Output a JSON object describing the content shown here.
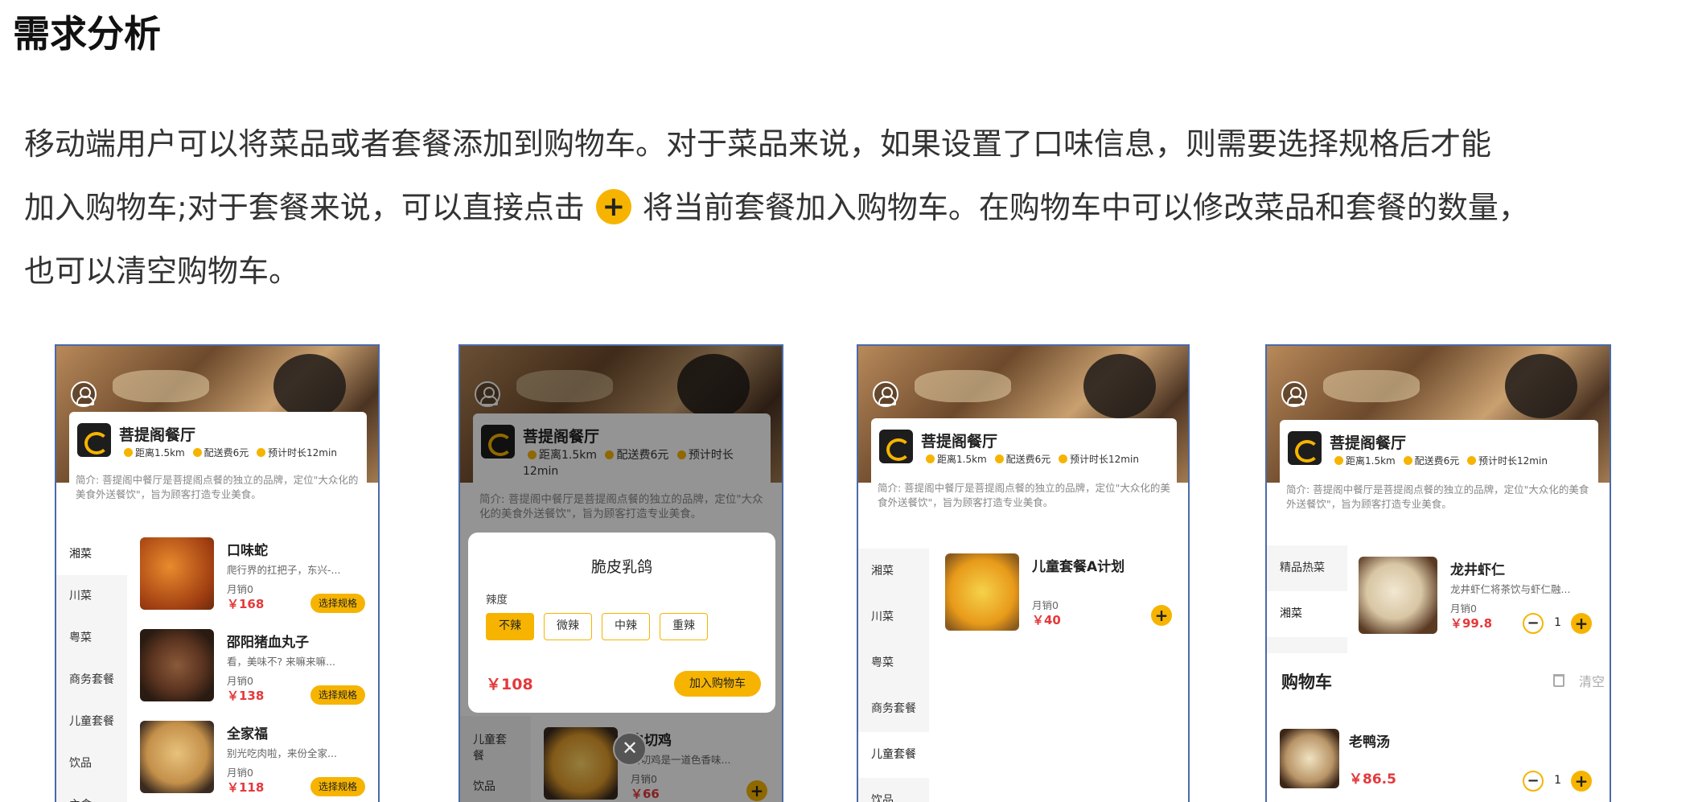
{
  "heading": "需求分析",
  "description": {
    "line1": "移动端用户可以将菜品或者套餐添加到购物车。对于菜品来说，如果设置了口味信息，则需要选择规格后才能",
    "line2_before": "加入购物车;对于套餐来说，可以直接点击",
    "inline_icon": "plus-icon",
    "line2_after": "将当前套餐加入购物车。在购物车中可以修改菜品和套餐的数量，",
    "line3": "也可以清空购物车。"
  },
  "colors": {
    "accent": "#f6b400",
    "price": "#e4393c",
    "frame": "#4a6aa8"
  },
  "shop": {
    "name": "菩提阁餐厅",
    "distance": "距离1.5km",
    "fee": "配送费6元",
    "eta": "预计时长12min",
    "intro_a": "简介: 菩提阁中餐厅是菩提阁点餐的独立的品牌，定位\"大众化的美食外送餐饮\"，旨为顾客打造专业美食。",
    "intro_b": "简介: 菩提阁中餐厅是菩提阁点餐的独立的品牌，定位\"大众 化的美食外送餐饮\"，旨为顾客打造专业美食。"
  },
  "screen1": {
    "categories": [
      "湘菜",
      "川菜",
      "粤菜",
      "商务套餐",
      "儿童套餐",
      "饮品",
      "主食"
    ],
    "dishes": [
      {
        "name": "口味蛇",
        "desc": "爬行界的扛把子，东兴-...",
        "sales": "月销0",
        "price": "￥168",
        "button": "选择规格"
      },
      {
        "name": "邵阳猪血丸子",
        "desc": "看，美味不? 来嘛来嘛...",
        "sales": "月销0",
        "price": "￥138",
        "button": "选择规格"
      },
      {
        "name": "全家福",
        "desc": "别光吃肉啦，来份全家...",
        "sales": "月销0",
        "price": "￥118",
        "button": "选择规格"
      }
    ]
  },
  "screen2": {
    "dialog_title": "脆皮乳鸽",
    "flavor_label": "辣度",
    "flavors": [
      "不辣",
      "微辣",
      "中辣",
      "重辣"
    ],
    "price": "￥108",
    "add_to_cart": "加入购物车",
    "categories": [
      "儿童套餐",
      "饮品"
    ],
    "dish": {
      "name": "白切鸡",
      "desc": "白切鸡是一道色香味...",
      "sales": "月销0",
      "price": "￥66"
    },
    "close": "✕"
  },
  "screen3": {
    "categories": [
      "湘菜",
      "川菜",
      "粤菜",
      "商务套餐",
      "儿童套餐",
      "饮品"
    ],
    "dish": {
      "name": "儿童套餐A计划",
      "sales": "月销0",
      "price": "￥40"
    }
  },
  "screen4": {
    "categories": [
      "精品热菜",
      "湘菜"
    ],
    "dish": {
      "name": "龙井虾仁",
      "desc": "龙井虾仁将茶饮与虾仁融...",
      "sales": "月销0",
      "price": "￥99.8",
      "qty": "1"
    },
    "cart": {
      "title": "购物车",
      "clear": "清空",
      "item": {
        "name": "老鸭汤",
        "price": "￥86.5",
        "qty": "1"
      }
    }
  }
}
